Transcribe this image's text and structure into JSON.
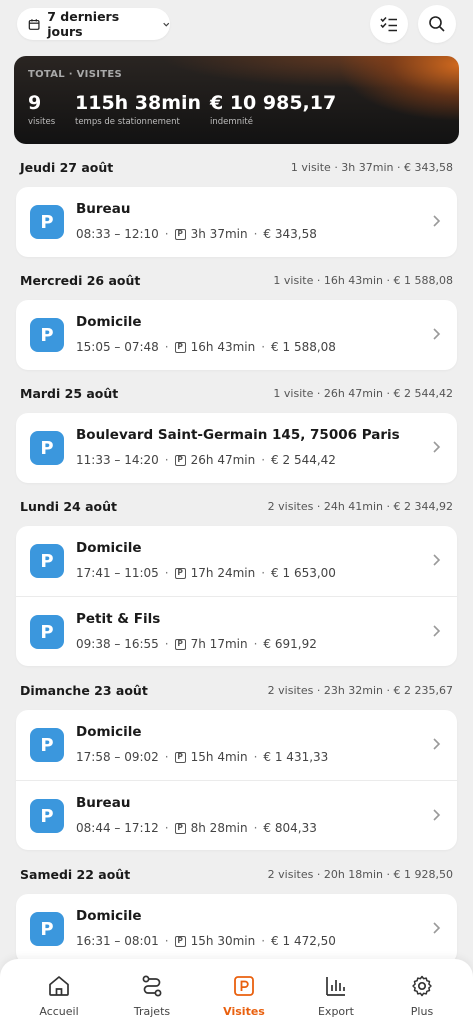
{
  "header": {
    "date_range": "7 derniers jours",
    "icons": {
      "calendar": "calendar-icon",
      "filter": "checklist-icon",
      "search": "search-icon"
    }
  },
  "summary": {
    "label": "TOTAL · VISITES",
    "visits_value": "9",
    "visits_unit": "visites",
    "duration_value": "115h 38min",
    "duration_unit": "temps de stationnement",
    "amount_value": "€ 10 985,17",
    "amount_unit": "indemnité"
  },
  "days": [
    {
      "label": "Jeudi 27 août",
      "summary": "1 visite · 3h 37min · € 343,58",
      "visits": [
        {
          "title": "Bureau",
          "time": "08:33 – 12:10",
          "duration": "3h 37min",
          "amount": "€ 343,58"
        }
      ]
    },
    {
      "label": "Mercredi 26 août",
      "summary": "1 visite · 16h 43min · € 1 588,08",
      "visits": [
        {
          "title": "Domicile",
          "time": "15:05 – 07:48",
          "duration": "16h 43min",
          "amount": "€ 1 588,08"
        }
      ]
    },
    {
      "label": "Mardi 25 août",
      "summary": "1 visite · 26h 47min · € 2 544,42",
      "visits": [
        {
          "title": "Boulevard Saint-Germain 145, 75006 Paris",
          "time": "11:33 – 14:20",
          "duration": "26h 47min",
          "amount": "€ 2 544,42"
        }
      ]
    },
    {
      "label": "Lundi 24 août",
      "summary": "2 visites · 24h 41min · € 2 344,92",
      "visits": [
        {
          "title": "Domicile",
          "time": "17:41 – 11:05",
          "duration": "17h 24min",
          "amount": "€ 1 653,00"
        },
        {
          "title": "Petit & Fils",
          "time": "09:38 – 16:55",
          "duration": "7h 17min",
          "amount": "€ 691,92"
        }
      ]
    },
    {
      "label": "Dimanche 23 août",
      "summary": "2 visites · 23h 32min · € 2 235,67",
      "visits": [
        {
          "title": "Domicile",
          "time": "17:58 – 09:02",
          "duration": "15h 4min",
          "amount": "€ 1 431,33"
        },
        {
          "title": "Bureau",
          "time": "08:44 – 17:12",
          "duration": "8h 28min",
          "amount": "€ 804,33"
        }
      ]
    },
    {
      "label": "Samedi 22 août",
      "summary": "2 visites · 20h 18min · € 1 928,50",
      "visits": [
        {
          "title": "Domicile",
          "time": "16:31 – 08:01",
          "duration": "15h 30min",
          "amount": "€ 1 472,50"
        }
      ]
    }
  ],
  "parking_glyph": "P",
  "nav": {
    "active": "visites",
    "items": [
      {
        "id": "accueil",
        "label": "Accueil",
        "icon": "home-icon"
      },
      {
        "id": "trajets",
        "label": "Trajets",
        "icon": "route-icon"
      },
      {
        "id": "visites",
        "label": "Visites",
        "icon": "parking-icon"
      },
      {
        "id": "export",
        "label": "Export",
        "icon": "bar-chart-icon"
      },
      {
        "id": "plus",
        "label": "Plus",
        "icon": "gear-icon"
      }
    ]
  },
  "colors": {
    "accent": "#e9600e",
    "parking_blue": "#3b97dd",
    "summary_dark": "#121212"
  }
}
